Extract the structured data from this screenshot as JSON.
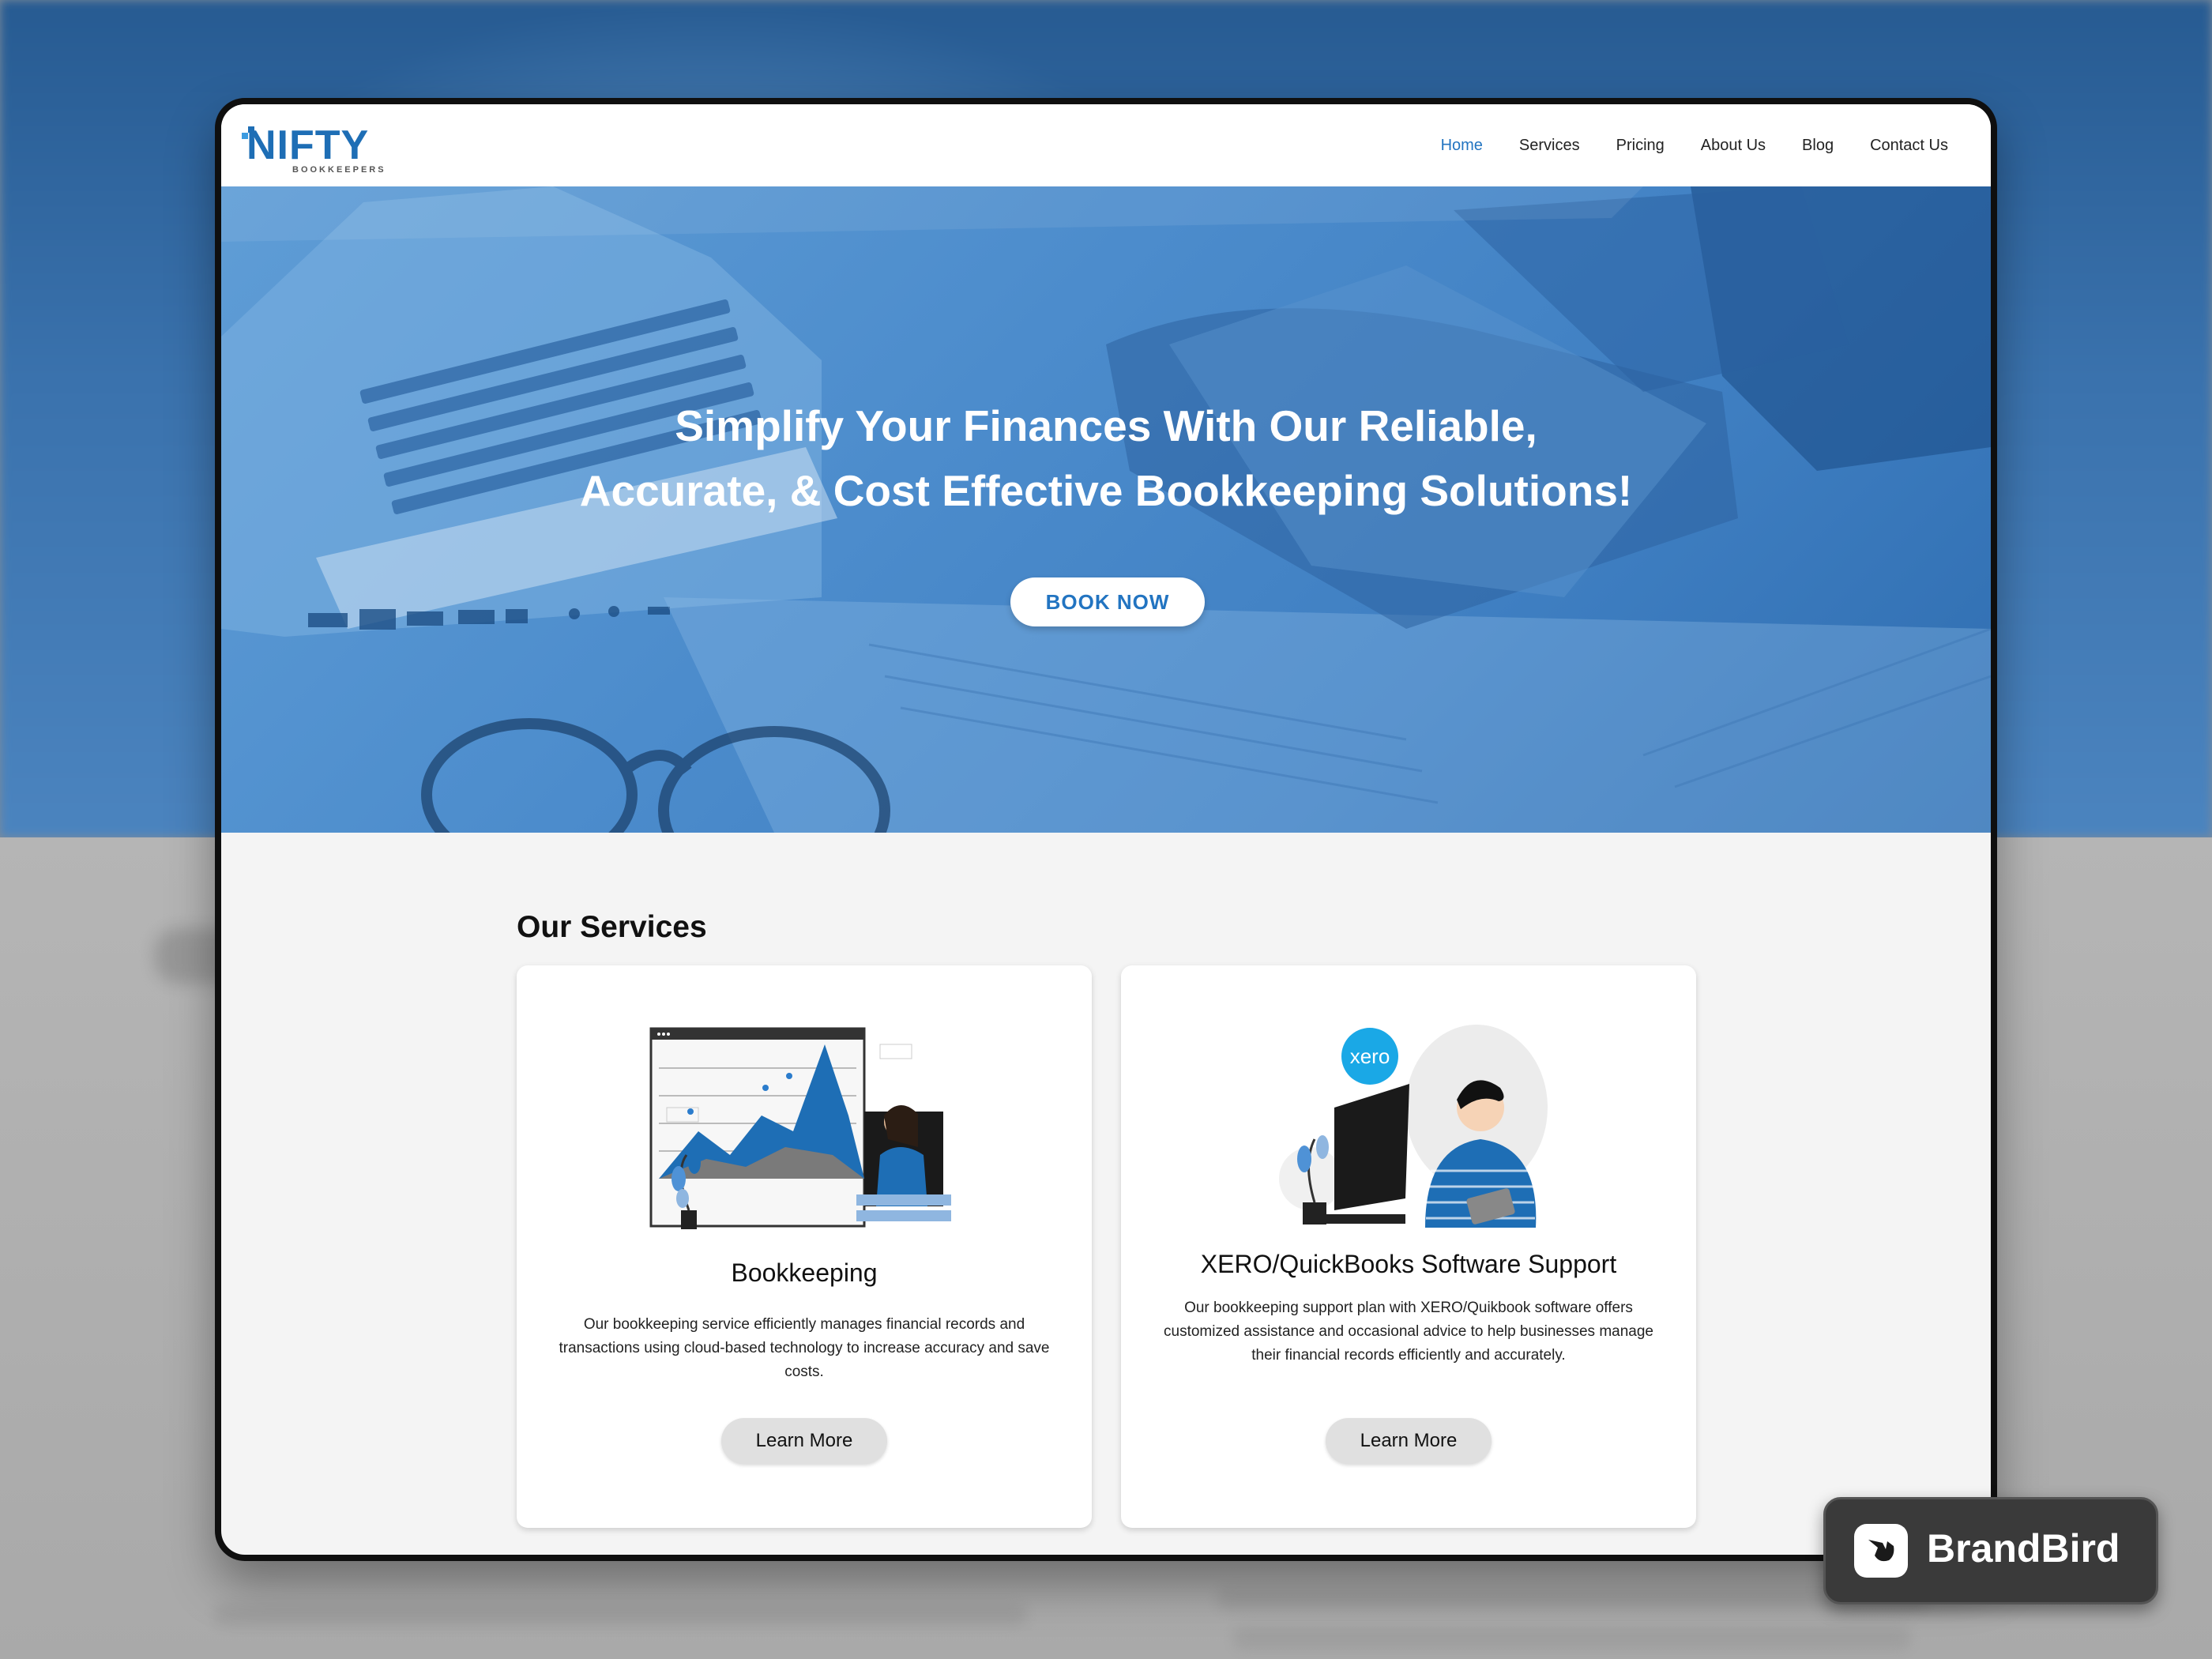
{
  "brand": {
    "logo_main": "NIFTY",
    "logo_sub": "BOOKKEEPERS",
    "primary": "#2274c1"
  },
  "nav": {
    "items": [
      {
        "label": "Home",
        "active": true
      },
      {
        "label": "Services",
        "active": false
      },
      {
        "label": "Pricing",
        "active": false
      },
      {
        "label": "About Us",
        "active": false
      },
      {
        "label": "Blog",
        "active": false
      },
      {
        "label": "Contact Us",
        "active": false
      }
    ]
  },
  "hero": {
    "title_line1": "Simplify Your Finances With Our Reliable,",
    "title_line2": "Accurate, & Cost Effective Bookkeeping Solutions!",
    "cta_label": "BOOK NOW"
  },
  "services": {
    "heading": "Our Services",
    "cards": [
      {
        "title": "Bookkeeping",
        "description": "Our bookkeeping service efficiently manages financial records and transactions using cloud-based technology to increase accuracy and save costs.",
        "button_label": "Learn More",
        "illustration": "chart-analyst-illustration"
      },
      {
        "title": "XERO/QuickBooks Software Support",
        "description": "Our bookkeeping support plan with XERO/Quikbook software offers customized assistance and occasional advice to help businesses manage their financial records efficiently and accurately.",
        "button_label": "Learn More",
        "illustration": "xero-user-illustration",
        "badge_text": "xero"
      }
    ]
  },
  "watermark": {
    "label": "BrandBird",
    "icon": "brandbird-logo-icon"
  }
}
